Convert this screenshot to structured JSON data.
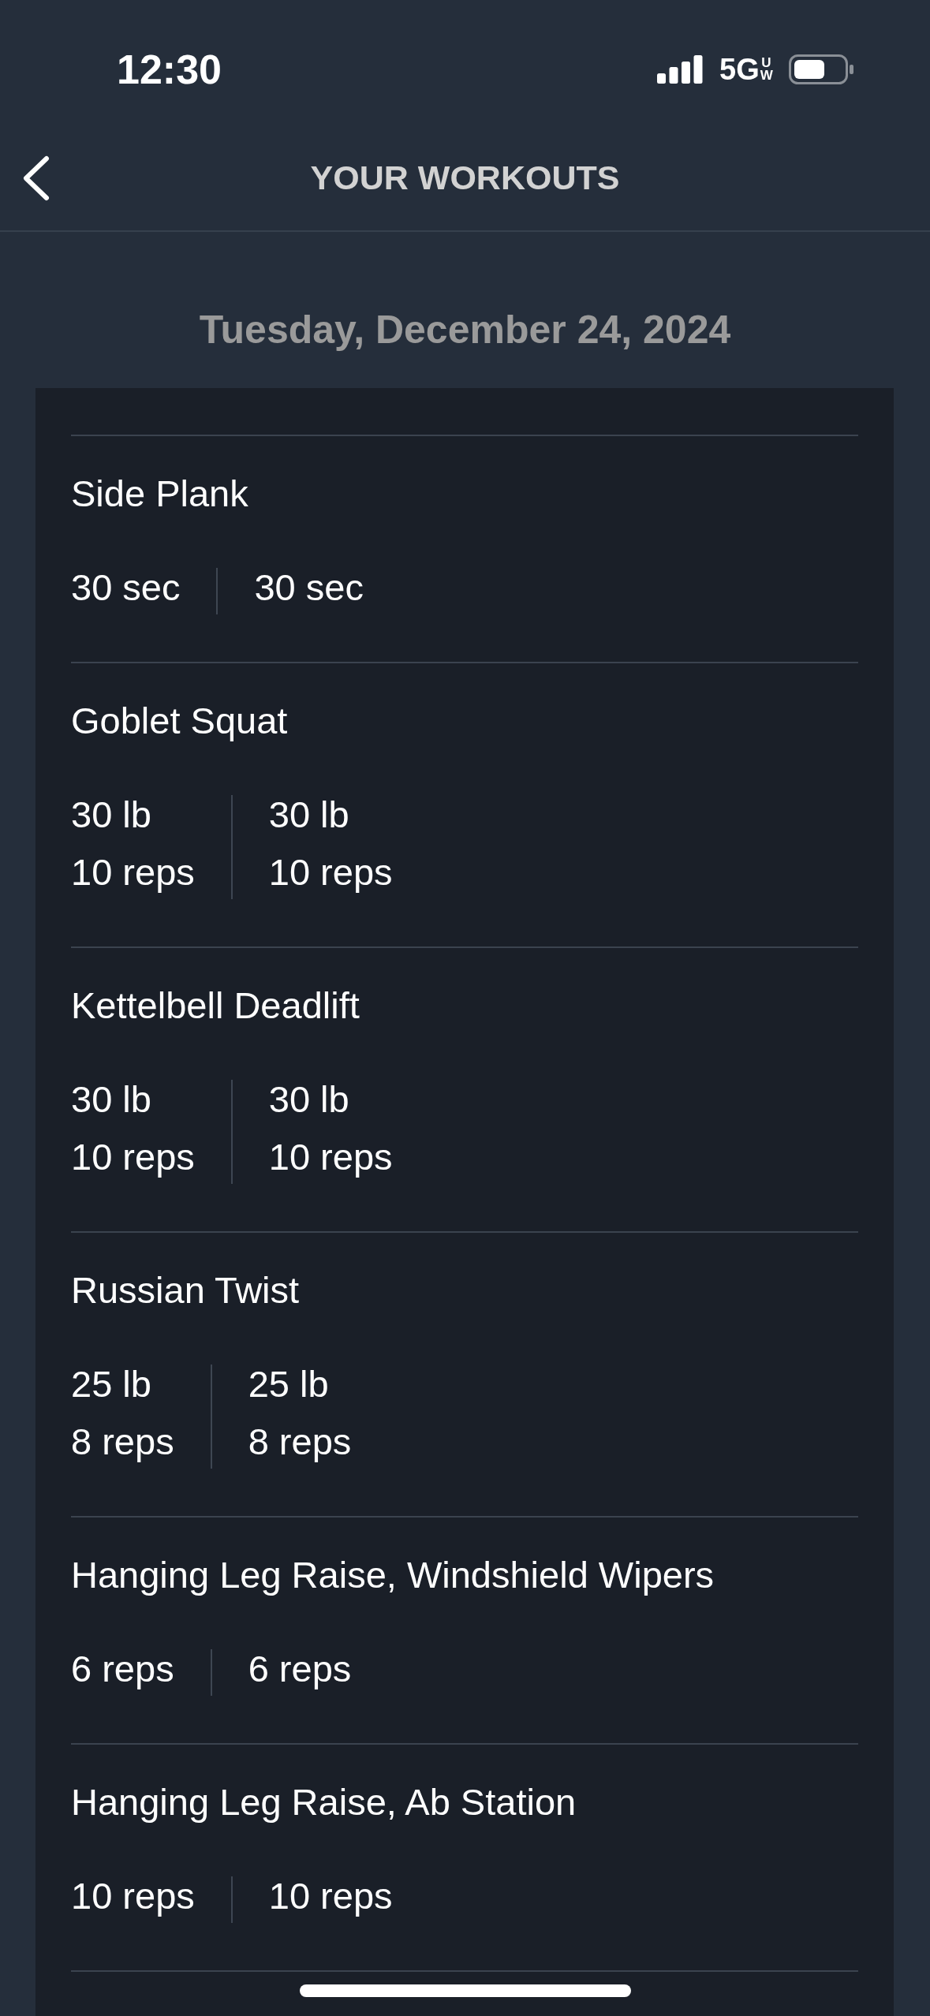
{
  "status_bar": {
    "time": "12:30",
    "network": "5G",
    "network_badge": "UW"
  },
  "nav": {
    "title": "YOUR WORKOUTS"
  },
  "date": "Tuesday, December 24, 2024",
  "workouts": [
    {
      "name": "Side Plank",
      "sets": [
        [
          "30 sec"
        ],
        [
          "30 sec"
        ]
      ]
    },
    {
      "name": "Goblet Squat",
      "sets": [
        [
          "30 lb",
          "10 reps"
        ],
        [
          "30 lb",
          "10 reps"
        ]
      ]
    },
    {
      "name": "Kettelbell Deadlift",
      "sets": [
        [
          "30 lb",
          "10 reps"
        ],
        [
          "30 lb",
          "10 reps"
        ]
      ]
    },
    {
      "name": "Russian Twist",
      "sets": [
        [
          "25 lb",
          "8 reps"
        ],
        [
          "25 lb",
          "8 reps"
        ]
      ]
    },
    {
      "name": "Hanging Leg Raise, Windshield Wipers",
      "sets": [
        [
          "6 reps"
        ],
        [
          "6 reps"
        ]
      ]
    },
    {
      "name": "Hanging Leg Raise, Ab Station",
      "sets": [
        [
          "10 reps"
        ],
        [
          "10 reps"
        ]
      ]
    }
  ]
}
